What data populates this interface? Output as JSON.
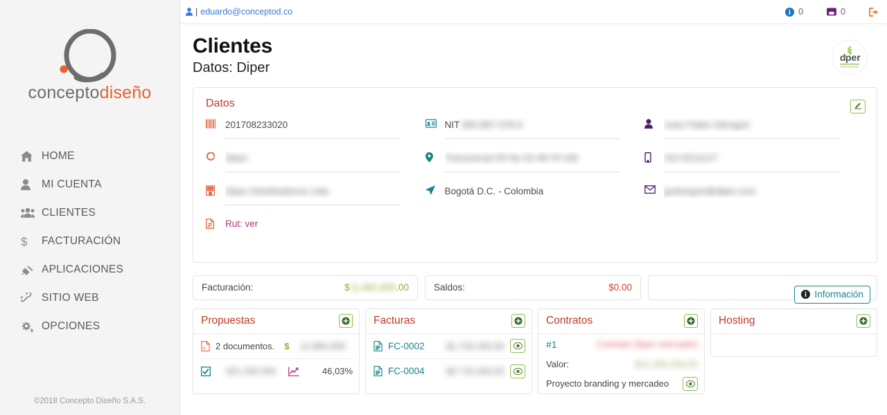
{
  "sidebar": {
    "brand": {
      "word1": "concepto",
      "word2": "diseño"
    },
    "items": [
      {
        "label": "HOME",
        "icon": "home-icon"
      },
      {
        "label": "MI CUENTA",
        "icon": "user-icon"
      },
      {
        "label": "CLIENTES",
        "icon": "users-icon"
      },
      {
        "label": "FACTURACIÓN",
        "icon": "dollar-icon"
      },
      {
        "label": "APLICACIONES",
        "icon": "plug-icon"
      },
      {
        "label": "SITIO WEB",
        "icon": "link-icon"
      },
      {
        "label": "OPCIONES",
        "icon": "gears-icon"
      }
    ],
    "copyright": "©2018 Concepto Diseño S.A.S."
  },
  "topbar": {
    "separator": "|",
    "user_email": "eduardo@conceptod.co",
    "notifications_count": "0",
    "messages_count": "0",
    "logout_icon": "logout-icon"
  },
  "page": {
    "title": "Clientes",
    "subtitle": "Datos: Diper",
    "client_logo_text": "diper"
  },
  "datos": {
    "title": "Datos",
    "edit_icon": "edit-icon",
    "fields": [
      {
        "icon": "barcode-icon",
        "value": "201708233020",
        "blurred": false,
        "underline": true
      },
      {
        "icon": "circle-notch-icon",
        "value": "Diper",
        "blurred": true,
        "underline": true
      },
      {
        "icon": "building-icon",
        "value": "Diper Distribuidores Ltda.",
        "blurred": true,
        "underline": true
      },
      {
        "icon": "file-icon",
        "value": "Rut: ver",
        "blurred": false,
        "underline": false,
        "link": true
      },
      {
        "icon": "id-card-icon",
        "label": "NIT",
        "value": "900.887.378-9",
        "blurred": true,
        "underline": true
      },
      {
        "icon": "map-marker-icon",
        "value": "Transversal 93 No 53-48 Of 106",
        "blurred": true,
        "underline": true
      },
      {
        "icon": "location-arrow-icon",
        "value": "Bogotá D.C. - Colombia",
        "blurred": false,
        "underline": false
      },
      {
        "icon": "person-icon",
        "value": "Juan Pablo Obregón",
        "blurred": true,
        "underline": true
      },
      {
        "icon": "mobile-icon",
        "value": "310 8211127",
        "blurred": true,
        "underline": true
      },
      {
        "icon": "envelope-icon",
        "value": "jpobregon@diper.com",
        "blurred": true,
        "underline": false
      }
    ]
  },
  "summary": {
    "facturacion_label": "Facturación:",
    "facturacion_currency": "$",
    "facturacion_value": "11.862.800",
    "facturacion_decimals": ".00",
    "saldos_label": "Saldos:",
    "saldos_value": "$0.00",
    "info_button_label": "Información",
    "info_button_icon": "info-circle-icon"
  },
  "cards": [
    {
      "title": "Propuestas",
      "add_icon": "add-circle-icon",
      "rows": [
        {
          "kind": "two-col",
          "left_icon": "pdf-file-icon",
          "left_text": "2 documentos.",
          "right_icon": "dollar-icon",
          "right_value": "12.860.000",
          "right_blurred": true
        },
        {
          "kind": "two-col",
          "left_icon": "check-square-icon",
          "left_value": "921.200.000",
          "left_blurred": true,
          "right_icon": "chart-line-icon",
          "right_text": "46,03%"
        }
      ]
    },
    {
      "title": "Facturas",
      "add_icon": "add-circle-icon",
      "rows": [
        {
          "kind": "doc",
          "icon": "invoice-file-icon",
          "label": "FC-0002",
          "value": "$1.720.200,00",
          "blurred": true,
          "action_icon": "eye-icon"
        },
        {
          "kind": "doc",
          "icon": "invoice-file-icon",
          "label": "FC-0004",
          "value": "$2.715.200,00",
          "blurred": true,
          "action_icon": "eye-icon"
        }
      ]
    },
    {
      "title": "Contratos",
      "add_icon": "add-circle-icon",
      "rows": [
        {
          "kind": "contract-num",
          "label": "#1",
          "value": "Contrato Diper mercadeo",
          "blurred": true,
          "blur_color": "red"
        },
        {
          "kind": "contract-val",
          "label": "Valor:",
          "value": "$21.400.000,00",
          "blurred": true,
          "blur_color": "green"
        },
        {
          "kind": "contract-desc",
          "label": "Proyecto branding y mercadeo",
          "action_icon": "eye-icon"
        }
      ]
    },
    {
      "title": "Hosting",
      "add_icon": "add-circle-icon",
      "rows": []
    }
  ],
  "colors": {
    "brand_orange": "#e8622a",
    "brand_gray": "#6d6d6d",
    "card_title_red": "#c0392b",
    "teal": "#18848a",
    "green_border": "#8cbf4a",
    "link_blue": "#3a7bd5",
    "amount_green": "#8bb03a",
    "amount_red": "#e03a2f"
  }
}
